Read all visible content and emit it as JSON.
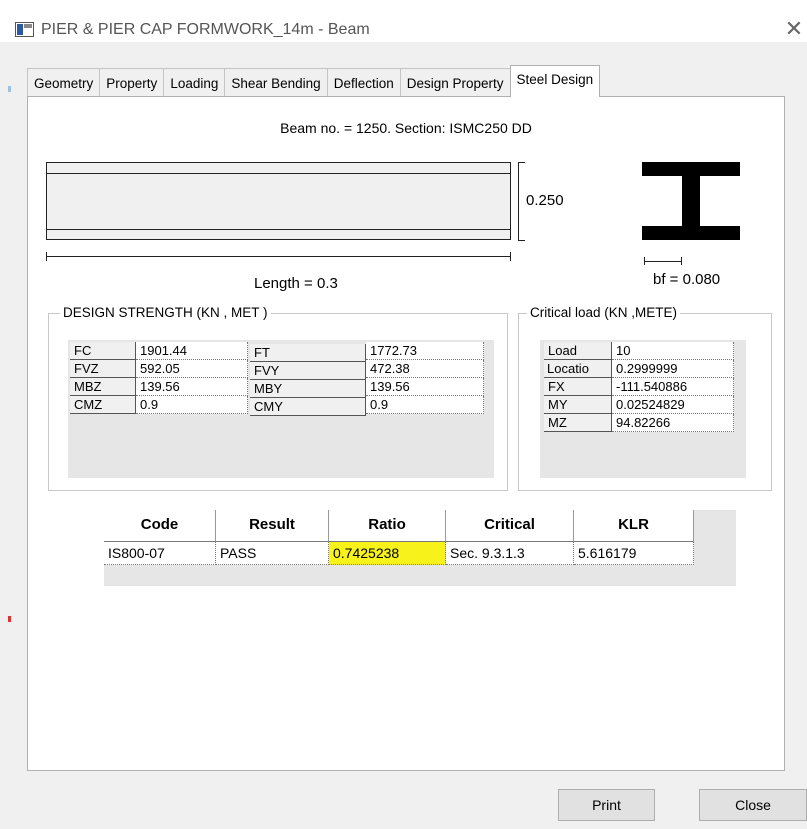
{
  "window": {
    "title": "PIER & PIER CAP FORMWORK_14m - Beam",
    "close_glyph": "✕",
    "icon": "window-app-icon"
  },
  "tabs": [
    {
      "label": "Geometry",
      "active": false
    },
    {
      "label": "Property",
      "active": false
    },
    {
      "label": "Loading",
      "active": false
    },
    {
      "label": "Shear Bending",
      "active": false
    },
    {
      "label": "Deflection",
      "active": false
    },
    {
      "label": "Design Property",
      "active": false
    },
    {
      "label": "Steel Design",
      "active": true
    }
  ],
  "diagram": {
    "beam_info": "Beam no. = 1250. Section: ISMC250 DD",
    "depth_label": "0.250",
    "length_label": "Length = 0.3",
    "bf_label": "bf = 0.080"
  },
  "design_strength": {
    "title": "DESIGN STRENGTH (KN , MET )",
    "rows": [
      {
        "k1": "FC",
        "v1": "1901.44",
        "k2": "FT",
        "v2": "1772.73"
      },
      {
        "k1": "FVZ",
        "v1": "592.05",
        "k2": "FVY",
        "v2": "472.38"
      },
      {
        "k1": "MBZ",
        "v1": "139.56",
        "k2": "MBY",
        "v2": "139.56"
      },
      {
        "k1": "CMZ",
        "v1": "0.9",
        "k2": "CMY",
        "v2": "0.9"
      }
    ]
  },
  "critical_load": {
    "title": "Critical load (KN ,METE)",
    "rows": [
      {
        "k": "Load",
        "v": "10"
      },
      {
        "k": "Locatio",
        "v": "0.2999999"
      },
      {
        "k": "FX",
        "v": "-111.540886"
      },
      {
        "k": "MY",
        "v": "0.02524829"
      },
      {
        "k": "MZ",
        "v": "94.82266"
      }
    ]
  },
  "results": {
    "headers": [
      "Code",
      "Result",
      "Ratio",
      "Critical",
      "KLR"
    ],
    "row": [
      "IS800-07",
      "PASS",
      "0.7425238",
      "Sec. 9.3.1.3",
      "5.616179"
    ],
    "highlight_color": "#f6f21a"
  },
  "buttons": {
    "print": "Print",
    "close": "Close"
  }
}
